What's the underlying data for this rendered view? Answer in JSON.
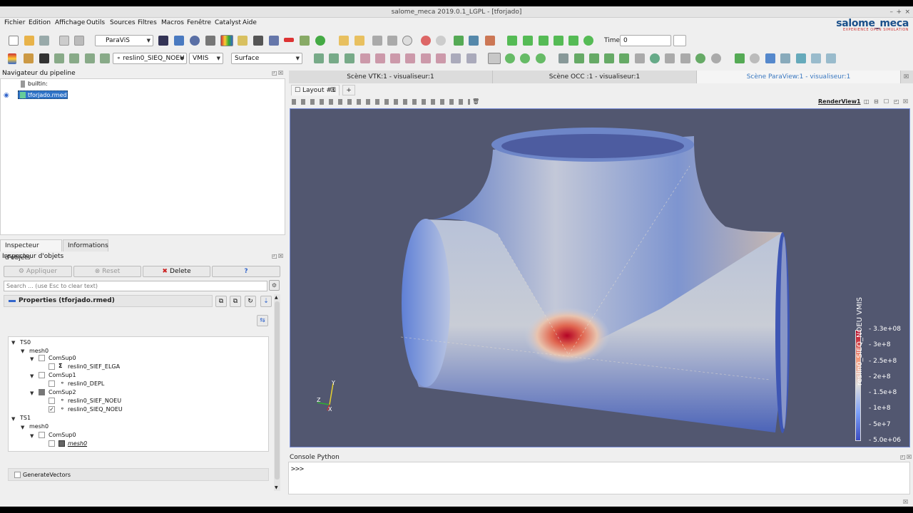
{
  "window": {
    "title": "salome_meca 2019.0.1_LGPL - [tforjado]"
  },
  "menu": [
    "Fichier",
    "Edition",
    "Affichage",
    "Outils",
    "Sources",
    "Filtres",
    "Macros",
    "Fenêtre",
    "Catalyst",
    "Aide"
  ],
  "logo": {
    "main": "salome_meca",
    "sub": "EXPERIENCE OPEN SIMULATION"
  },
  "toolbar1": {
    "module": "ParaViS",
    "time_label": "Time:",
    "time_value": "0"
  },
  "toolbar2": {
    "array": "reslin0_SIEQ_NOEU",
    "component": "VMIS",
    "representation": "Surface"
  },
  "pipeline": {
    "title": "Navigateur du pipeline",
    "items": [
      {
        "label": "builtin:"
      },
      {
        "label": "tforjado.rmed",
        "selected": true
      }
    ]
  },
  "inspector": {
    "tabs": [
      "Inspecteur d'objets",
      "Informations"
    ],
    "title": "Inspecteur d'objets",
    "buttons": {
      "apply": "Appliquer",
      "reset": "Reset",
      "delete": "Delete",
      "help": "?"
    },
    "search_placeholder": "Search ... (use Esc to clear text)",
    "properties_title": "Properties (tforjado.rmed)",
    "tree": [
      {
        "label": "TS0",
        "level": 0,
        "expander": true
      },
      {
        "label": "mesh0",
        "level": 1,
        "expander": true
      },
      {
        "label": "ComSup0",
        "level": 2,
        "expander": true,
        "check": "off"
      },
      {
        "label": "reslin0_SIEF_ELGA",
        "level": 3,
        "check": "off",
        "icon": "sigma-icon"
      },
      {
        "label": "ComSup1",
        "level": 2,
        "expander": true,
        "check": "off"
      },
      {
        "label": "reslin0_DEPL",
        "level": 3,
        "check": "off",
        "icon": "point-icon"
      },
      {
        "label": "ComSup2",
        "level": 2,
        "expander": true,
        "check": "partial"
      },
      {
        "label": "reslin0_SIEF_NOEU",
        "level": 3,
        "check": "off",
        "icon": "point-icon"
      },
      {
        "label": "reslin0_SIEQ_NOEU",
        "level": 3,
        "check": "on",
        "icon": "point-icon"
      },
      {
        "label": "TS1",
        "level": 0,
        "expander": true
      },
      {
        "label": "mesh0",
        "level": 1,
        "expander": true
      },
      {
        "label": "ComSup0",
        "level": 2,
        "expander": true,
        "check": "off"
      },
      {
        "label": "mesh0",
        "level": 3,
        "check": "off",
        "icon": "mesh-icon",
        "italic": true
      }
    ],
    "generate_vectors": "GenerateVectors"
  },
  "view_tabs": [
    "Scène VTK:1 - visualiseur:1",
    "Scène OCC :1 - visualiseur:1",
    "Scène ParaView:1 - visualiseur:1"
  ],
  "layout_tab": "Layout #1",
  "render_view_label": "RenderView1",
  "legend": {
    "title": "reslin0_SIEQ_NOEU VMIS",
    "ticks": [
      "3.3e+08",
      "3e+8",
      "2.5e+8",
      "2e+8",
      "1.5e+8",
      "1e+8",
      "5e+7",
      "5.0e+06"
    ],
    "colors": [
      "#b40426",
      "#f4987a",
      "#dddddd",
      "#7b9ff9",
      "#3b4cc0"
    ]
  },
  "axes": {
    "x": "X",
    "y": "Y",
    "z": "Z"
  },
  "console": {
    "title": "Console Python",
    "prompt": ">>>"
  }
}
